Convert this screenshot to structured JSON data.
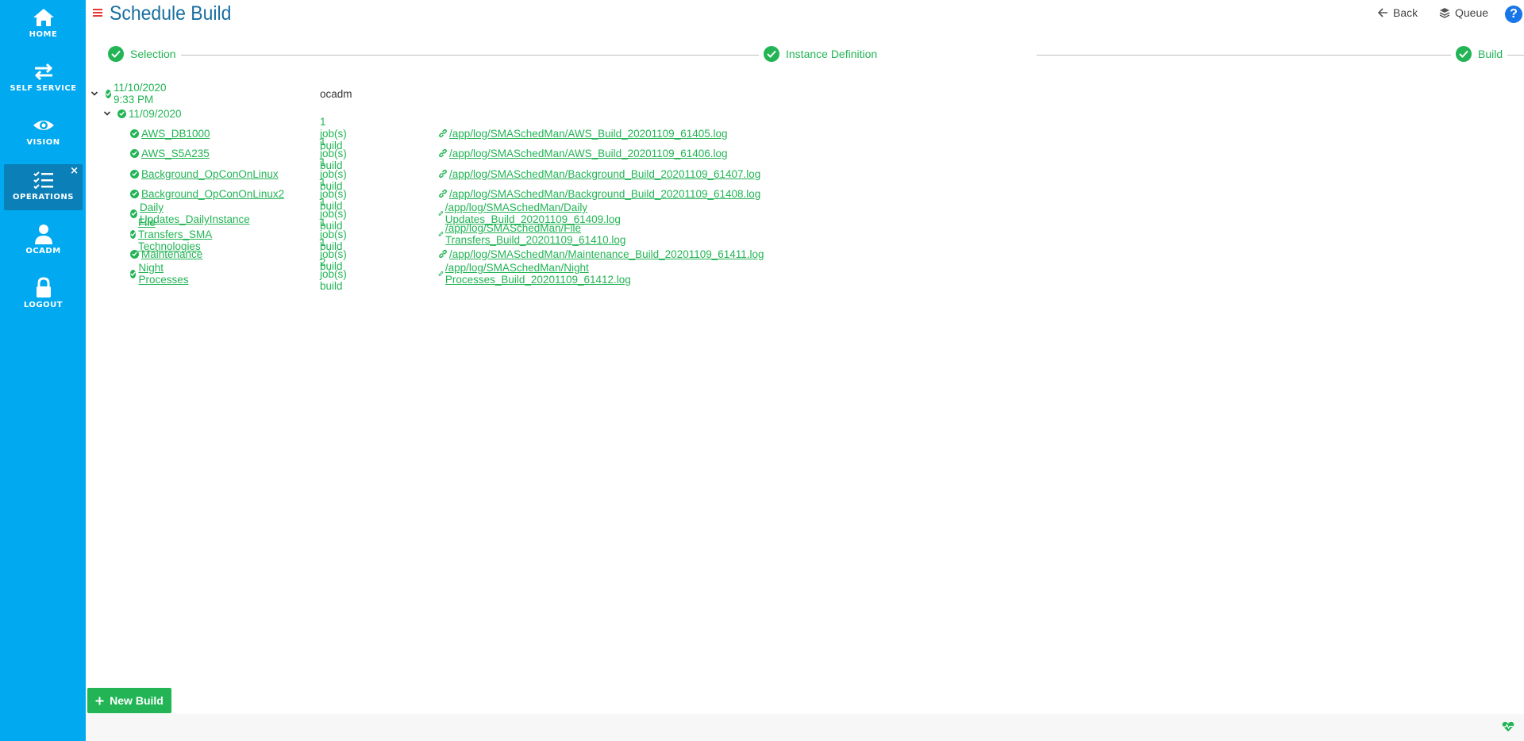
{
  "sidebar": {
    "items": [
      {
        "label": "HOME",
        "icon": "home-icon"
      },
      {
        "label": "SELF SERVICE",
        "icon": "swap-arrows-icon"
      },
      {
        "label": "VISION",
        "icon": "eye-icon"
      },
      {
        "label": "OPERATIONS",
        "icon": "checklist-icon",
        "active": true,
        "close": "×"
      },
      {
        "label": "OCADM",
        "icon": "user-icon"
      },
      {
        "label": "LOGOUT",
        "icon": "lock-icon"
      }
    ]
  },
  "header": {
    "title": "Schedule Build",
    "back_label": "Back",
    "queue_label": "Queue",
    "help_label": "?"
  },
  "stepper": {
    "steps": [
      {
        "label": "Selection",
        "status": "complete"
      },
      {
        "label": "Instance Definition",
        "status": "complete"
      },
      {
        "label": "Build",
        "status": "complete"
      }
    ]
  },
  "tree": {
    "root": {
      "label": "11/10/2020 9:33 PM",
      "user": "ocadm"
    },
    "date_node": {
      "label": "11/09/2020"
    },
    "schedules": [
      {
        "name": "AWS_DB1000",
        "jobs": "1 job(s) build",
        "log": "/app/log/SMASchedMan/AWS_Build_20201109_61405.log"
      },
      {
        "name": "AWS_S5A235",
        "jobs": "1 job(s) build",
        "log": "/app/log/SMASchedMan/AWS_Build_20201109_61406.log"
      },
      {
        "name": "Background_OpConOnLinux",
        "jobs": "1 job(s) build",
        "log": "/app/log/SMASchedMan/Background_Build_20201109_61407.log"
      },
      {
        "name": "Background_OpConOnLinux2",
        "jobs": "1 job(s) build",
        "log": "/app/log/SMASchedMan/Background_Build_20201109_61408.log"
      },
      {
        "name": "Daily Updates_DailyInstance",
        "jobs": "1 job(s) build",
        "log": "/app/log/SMASchedMan/Daily Updates_Build_20201109_61409.log"
      },
      {
        "name": "File Transfers_SMA Technologies",
        "jobs": "1 job(s) build",
        "log": "/app/log/SMASchedMan/File Transfers_Build_20201109_61410.log"
      },
      {
        "name": "Maintenance",
        "jobs": "1 job(s) build",
        "log": "/app/log/SMASchedMan/Maintenance_Build_20201109_61411.log"
      },
      {
        "name": "Night Processes",
        "jobs": "2 job(s) build",
        "log": "/app/log/SMASchedMan/Night Processes_Build_20201109_61412.log"
      }
    ]
  },
  "footer": {
    "new_build_label": "New Build"
  },
  "colors": {
    "sidebar": "#00a9f0",
    "sidebar_active": "#0a7fb8",
    "success": "#22b455",
    "title": "#1a6fa0",
    "help": "#1976e8"
  }
}
